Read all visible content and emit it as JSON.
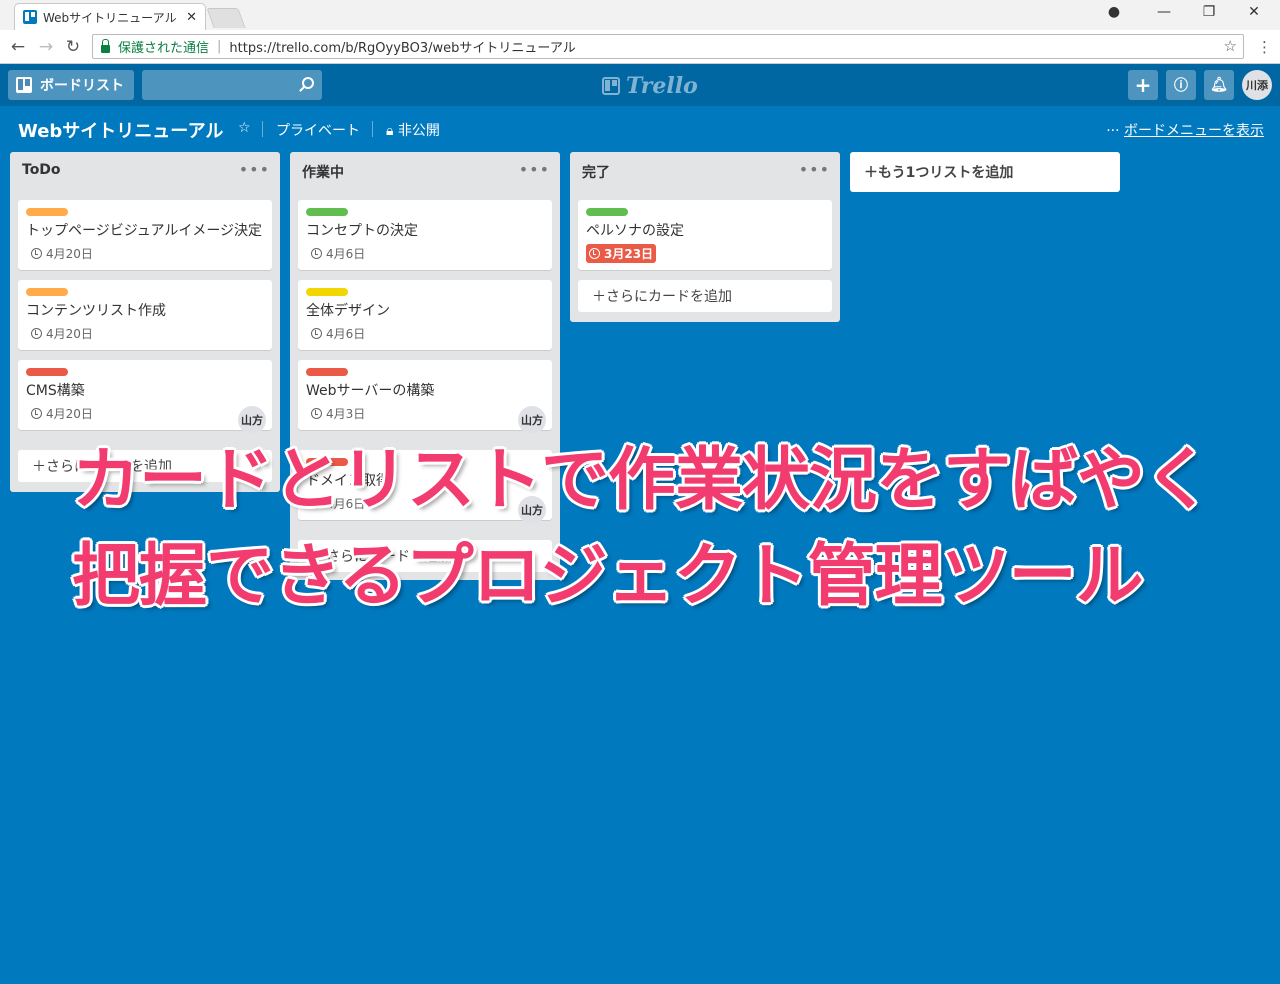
{
  "browser": {
    "tab_title": "Webサイトリニューアル | Trel",
    "secure_label": "保護された通信",
    "url": "https://trello.com/b/RgOyyBO3/webサイトリニューアル"
  },
  "header": {
    "boards_label": "ボードリスト",
    "logo_text": "Trello",
    "avatar_initials": "川添"
  },
  "board": {
    "title": "Webサイトリニューアル",
    "team": "プライベート",
    "visibility": "非公開",
    "show_menu": "ボードメニューを表示"
  },
  "lists": [
    {
      "title": "ToDo",
      "cards": [
        {
          "label_color": "#ffab4a",
          "title": "トップページビジュアルイメージ決定",
          "due": "4月20日"
        },
        {
          "label_color": "#ffab4a",
          "title": "コンテンツリスト作成",
          "due": "4月20日"
        },
        {
          "label_color": "#eb5a46",
          "title": "CMS構築",
          "due": "4月20日",
          "member": "山方"
        }
      ],
      "add_card": "さらにカードを追加"
    },
    {
      "title": "作業中",
      "cards": [
        {
          "label_color": "#61bd4f",
          "title": "コンセプトの決定",
          "due": "4月6日"
        },
        {
          "label_color": "#f2d600",
          "title": "全体デザイン",
          "due": "4月6日"
        },
        {
          "label_color": "#eb5a46",
          "title": "Webサーバーの構築",
          "due": "4月3日",
          "member": "山方"
        },
        {
          "label_color": "#eb5a46",
          "title": "ドメイン取得",
          "due": "4月6日",
          "member": "山方"
        }
      ],
      "add_card": "さらにカードを追加"
    },
    {
      "title": "完了",
      "cards": [
        {
          "label_color": "#61bd4f",
          "title": "ペルソナの設定",
          "due": "3月23日"
        }
      ],
      "add_card": "さらにカードを追加"
    }
  ],
  "add_list": "もう1つリストを追加",
  "overlay": {
    "line1": "カードとリストで作業状況をすばやく",
    "line2": "把握できるプロジェクト管理ツール"
  }
}
